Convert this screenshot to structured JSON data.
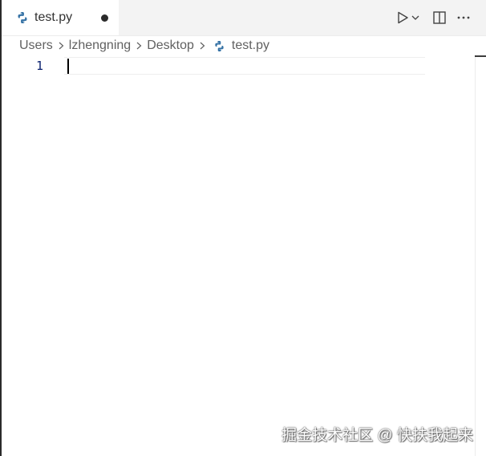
{
  "tab": {
    "label": "test.py",
    "icon": "python-file-icon",
    "unsaved": true
  },
  "actions": {
    "run_icon": "play-icon",
    "run_dropdown_icon": "chevron-down-icon",
    "split_icon": "split-editor-icon",
    "more_icon": "more-actions-icon"
  },
  "breadcrumb": {
    "items": [
      "Users",
      "lzhengning",
      "Desktop",
      "test.py"
    ]
  },
  "editor": {
    "line_numbers": [
      "1"
    ]
  },
  "watermark": "掘金技术社区 @ 快扶我起来",
  "colors": {
    "python_blue": "#3572a5",
    "line_number": "#0b216f",
    "tab_bar": "#f3f3f3"
  }
}
